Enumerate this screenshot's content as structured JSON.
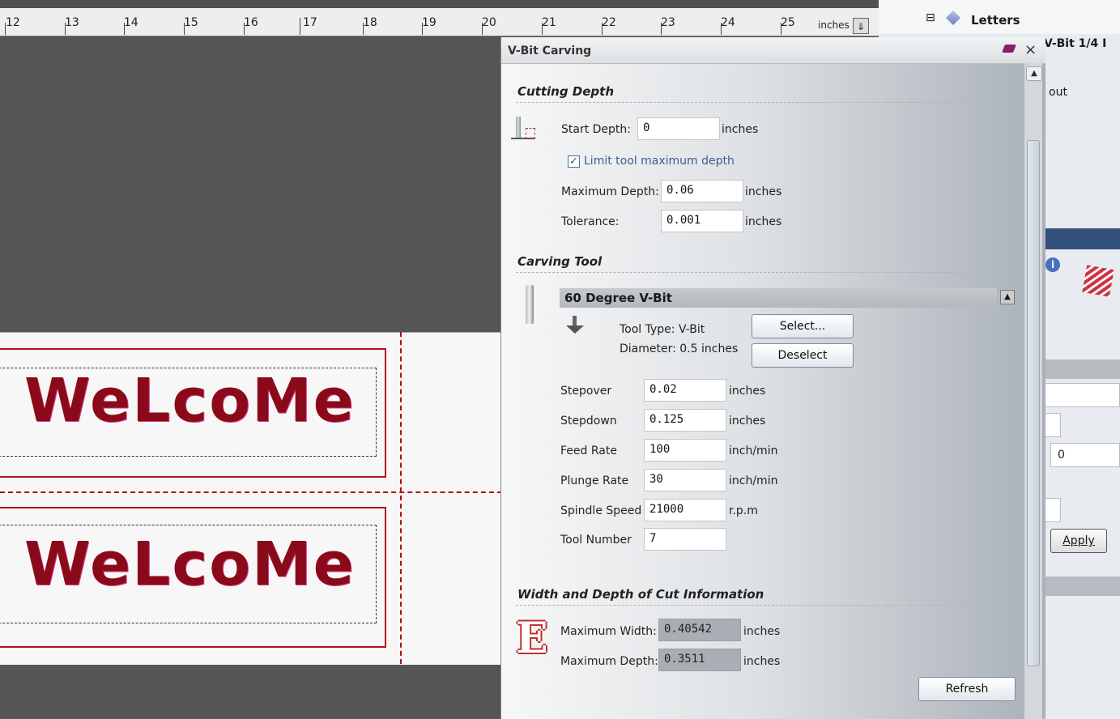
{
  "ruler": {
    "numbers": [
      "12",
      "13",
      "14",
      "15",
      "16",
      "17",
      "18",
      "19",
      "20",
      "21",
      "22",
      "23",
      "24",
      "25"
    ],
    "units_label": "inches",
    "units_button_glyph": "⇓"
  },
  "canvas": {
    "text_top": "WeLcoMe",
    "text_bottom": "WeLcoMe"
  },
  "right_panel": {
    "tree_item": "Letters",
    "tree_toggle": "⊟",
    "tool_label_partial": "V-Bit 1/4 I",
    "partial_text": "out",
    "field_value": "0",
    "apply_label": "Apply"
  },
  "dialog": {
    "title": "V-Bit Carving",
    "close_glyph": "×",
    "cutting_depth": {
      "heading": "Cutting Depth",
      "start_depth_label": "Start Depth:",
      "start_depth_value": "0",
      "start_depth_unit": "inches",
      "limit_label": "Limit tool maximum depth",
      "limit_checked": "✓",
      "max_depth_label": "Maximum Depth:",
      "max_depth_value": "0.06",
      "max_depth_unit": "inches",
      "tolerance_label": "Tolerance:",
      "tolerance_value": "0.001",
      "tolerance_unit": "inches"
    },
    "carving_tool": {
      "heading": "Carving Tool",
      "tool_name": "60 Degree V-Bit",
      "tool_type": "Tool Type: V-Bit",
      "diameter": "Diameter:  0.5 inches",
      "select_label": "Select...",
      "deselect_label": "Deselect",
      "collapse_glyph": "▲",
      "params": [
        {
          "label": "Stepover",
          "value": "0.02",
          "unit": "inches"
        },
        {
          "label": "Stepdown",
          "value": "0.125",
          "unit": "inches"
        },
        {
          "label": "Feed Rate",
          "value": "100",
          "unit": "inch/min"
        },
        {
          "label": "Plunge Rate",
          "value": "30",
          "unit": "inch/min"
        },
        {
          "label": "Spindle Speed",
          "value": "21000",
          "unit": "r.p.m"
        },
        {
          "label": "Tool Number",
          "value": "7",
          "unit": ""
        }
      ]
    },
    "cut_info": {
      "heading": "Width and Depth of Cut Information",
      "icon_letter": "E",
      "max_width_label": "Maximum Width:",
      "max_width_value": "0.40542",
      "max_width_unit": "inches",
      "max_depth_label": "Maximum Depth:",
      "max_depth_value": "0.3511",
      "max_depth_unit": "inches",
      "refresh_label": "Refresh"
    },
    "scroll_up_glyph": "▲"
  },
  "colors": {
    "accent_blue": "#34507c",
    "welcome_red": "#8b0a1a",
    "outline_red": "#b31414"
  }
}
